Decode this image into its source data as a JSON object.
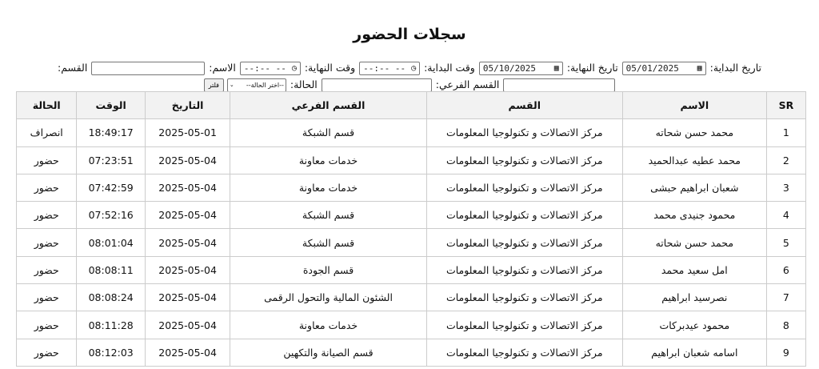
{
  "title": "سجلات الحضور",
  "filters": {
    "start_date_label": "تاريخ البداية:",
    "start_date_value": "05/01/2025",
    "end_date_label": "تاريخ النهاية:",
    "end_date_value": "05/10/2025",
    "start_time_label": "وقت البداية:",
    "start_time_value": "--:-- --",
    "end_time_label": "وقت النهاية:",
    "end_time_value": "--:-- --",
    "name_label": "الاسم:",
    "name_value": "",
    "department_label": "القسم:",
    "department_value": "",
    "subdepartment_label": "القسم الفرعي:",
    "subdepartment_value": "",
    "status_label": "الحالة:",
    "status_selected": "--اختر الحالة--",
    "filter_button": "فلتر"
  },
  "table": {
    "headers": [
      "SR",
      "الاسم",
      "القسم",
      "القسم الفرعي",
      "التاريخ",
      "الوقت",
      "الحالة"
    ],
    "rows": [
      [
        "1",
        "محمد حسن شحاته",
        "مركز الاتصالات و تكنولوجيا المعلومات",
        "قسم الشبكة",
        "2025-05-01",
        "18:49:17",
        "انصراف"
      ],
      [
        "2",
        "محمد عطيه عبدالحميد",
        "مركز الاتصالات و تكنولوجيا المعلومات",
        "خدمات معاونة",
        "2025-05-04",
        "07:23:51",
        "حضور"
      ],
      [
        "3",
        "شعبان ابراهيم حبشى",
        "مركز الاتصالات و تكنولوجيا المعلومات",
        "خدمات معاونة",
        "2025-05-04",
        "07:42:59",
        "حضور"
      ],
      [
        "4",
        "محمود جنيدى محمد",
        "مركز الاتصالات و تكنولوجيا المعلومات",
        "قسم الشبكة",
        "2025-05-04",
        "07:52:16",
        "حضور"
      ],
      [
        "5",
        "محمد حسن شحاته",
        "مركز الاتصالات و تكنولوجيا المعلومات",
        "قسم الشبكة",
        "2025-05-04",
        "08:01:04",
        "حضور"
      ],
      [
        "6",
        "امل سعيد محمد",
        "مركز الاتصالات و تكنولوجيا المعلومات",
        "قسم الجودة",
        "2025-05-04",
        "08:08:11",
        "حضور"
      ],
      [
        "7",
        "نصرسيد ابراهيم",
        "مركز الاتصالات و تكنولوجيا المعلومات",
        "الشئون المالية والتحول الرقمى",
        "2025-05-04",
        "08:08:24",
        "حضور"
      ],
      [
        "8",
        "محمود عيدبركات",
        "مركز الاتصالات و تكنولوجيا المعلومات",
        "خدمات معاونة",
        "2025-05-04",
        "08:11:28",
        "حضور"
      ],
      [
        "9",
        "اسامه شعبان ابراهيم",
        "مركز الاتصالات و تكنولوجيا المعلومات",
        "قسم الصيانة والتكهين",
        "2025-05-04",
        "08:12:03",
        "حضور"
      ]
    ]
  }
}
